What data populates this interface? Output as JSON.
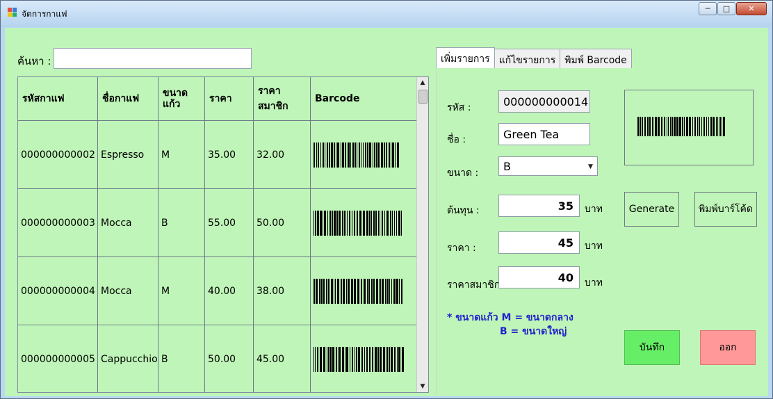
{
  "window": {
    "title": "จัดการกาแฟ"
  },
  "search": {
    "label": "ค้นหา :",
    "value": ""
  },
  "grid": {
    "headers": [
      "รหัสกาแฟ",
      "ชื่อกาแฟ",
      "ขนาด แก้ว",
      "ราคา",
      "ราคาสมาชิก",
      "Barcode"
    ],
    "header_size": [
      "ขนาด",
      "แก้ว"
    ],
    "rows": [
      {
        "id": "000000000002",
        "name": "Espresso",
        "size": "M",
        "price": "35.00",
        "member_price": "32.00"
      },
      {
        "id": "000000000003",
        "name": "Mocca",
        "size": "B",
        "price": "55.00",
        "member_price": "50.00"
      },
      {
        "id": "000000000004",
        "name": "Mocca",
        "size": "M",
        "price": "40.00",
        "member_price": "38.00"
      },
      {
        "id": "000000000005",
        "name": "Cappucchio",
        "size": "B",
        "price": "50.00",
        "member_price": "45.00"
      }
    ]
  },
  "tabs": [
    {
      "label": "เพิ่มรายการ",
      "active": true
    },
    {
      "label": "แก้ไขรายการ",
      "active": false
    },
    {
      "label": "พิมพ์ Barcode",
      "active": false
    }
  ],
  "form": {
    "code_label": "รหัส :",
    "code_value": "000000000014",
    "name_label": "ชื่อ :",
    "name_value": "Green Tea",
    "size_label": "ขนาด :",
    "size_value": "B",
    "cost_label": "ต้นทุน :",
    "cost_value": "35",
    "price_label": "ราคา :",
    "price_value": "45",
    "member_label": "ราคาสมาชิก :",
    "member_value": "40",
    "unit": "บาท",
    "note_line1": "* ขนาดแก้ว M = ขนาดกลาง",
    "note_line2": "B = ขนาดใหญ่"
  },
  "buttons": {
    "generate": "Generate",
    "print": "พิมพ์บาร์โค้ด",
    "save": "บันทึก",
    "exit": "ออก"
  },
  "colors": {
    "background": "#bff5b8",
    "save_button": "#66ee66",
    "exit_button": "#ff9999",
    "note_text": "#2222cc"
  }
}
